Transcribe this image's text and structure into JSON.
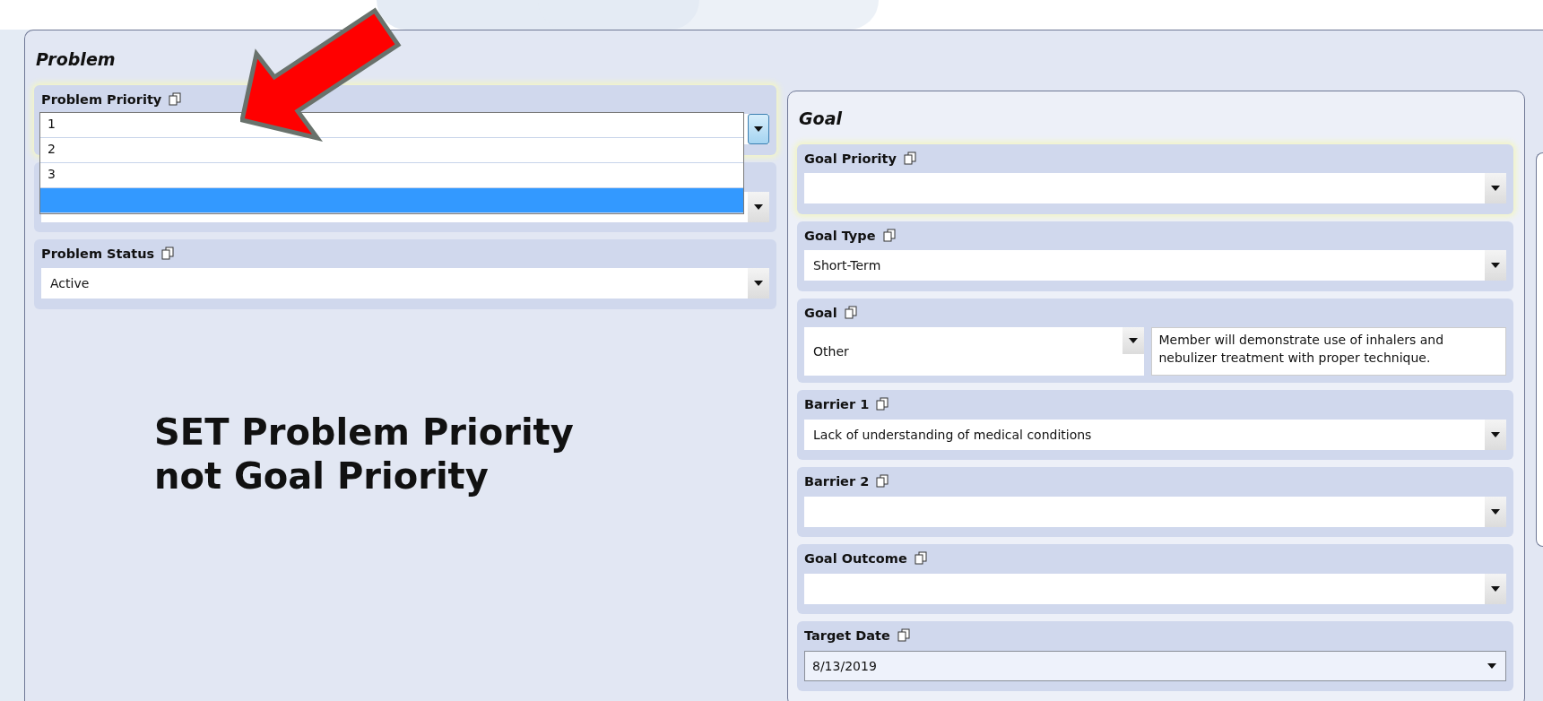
{
  "problem": {
    "title": "Problem",
    "fields": [
      {
        "kind": "dropdown",
        "label": "Problem Priority",
        "highlighted": true,
        "open": true,
        "options": [
          {
            "text": "1",
            "selected": false
          },
          {
            "text": "2",
            "selected": false
          },
          {
            "text": "3",
            "selected": false
          },
          {
            "selected": true
          }
        ]
      },
      {
        "kind": "covered"
      },
      {
        "kind": "dropdown",
        "label": "Problem Status",
        "highlighted": false,
        "open": false,
        "value": "Active"
      }
    ]
  },
  "annotation": {
    "lines": [
      "SET Problem Priority",
      "not Goal Priority"
    ]
  },
  "goal": {
    "title": "Goal",
    "fields": [
      {
        "kind": "dropdown",
        "label": "Goal Priority",
        "highlighted": true,
        "open": false
      },
      {
        "kind": "dropdown",
        "label": "Goal Type",
        "highlighted": false,
        "open": false,
        "value": "Short-Term"
      },
      {
        "kind": "split",
        "label": "Goal",
        "value": "Other",
        "note": "Member will demonstrate use of inhalers and nebulizer treatment with proper technique."
      },
      {
        "kind": "dropdown",
        "label": "Barrier 1",
        "highlighted": false,
        "open": false,
        "value": "Lack of understanding of medical conditions"
      },
      {
        "kind": "dropdown",
        "label": "Barrier 2",
        "highlighted": false,
        "open": false
      },
      {
        "kind": "dropdown",
        "label": "Goal Outcome",
        "highlighted": false,
        "open": false
      },
      {
        "kind": "date",
        "label": "Target Date",
        "value": "8/13/2019"
      }
    ]
  }
}
